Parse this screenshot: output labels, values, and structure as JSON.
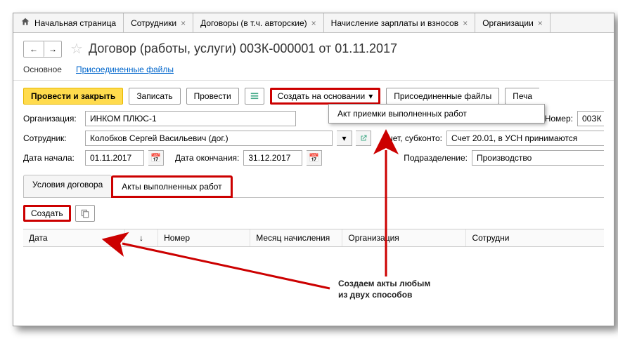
{
  "tabs": {
    "home": "Начальная страница",
    "t1": "Сотрудники",
    "t2": "Договоры (в т.ч. авторские)",
    "t3": "Начисление зарплаты и взносов",
    "t4": "Организации"
  },
  "title": "Договор (работы, услуги) 00ЗК-000001 от 01.11.2017",
  "subTabs": {
    "main": "Основное",
    "files": "Присоединенные файлы"
  },
  "toolbar": {
    "postClose": "Провести и закрыть",
    "save": "Записать",
    "post": "Провести",
    "createOn": "Создать на основании",
    "attached": "Присоединенные файлы",
    "print": "Печа"
  },
  "dropdown": {
    "item1": "Акт приемки выполненных работ"
  },
  "fields": {
    "orgLabel": "Организация:",
    "orgValue": "ИНКОМ ПЛЮС-1",
    "numLabel": "Номер:",
    "numValue": "00ЗК",
    "empLabel": "Сотрудник:",
    "empValue": "Колобков Сергей Васильевич (дог.)",
    "accLabel": "Счет, субконто:",
    "accValue": "Счет 20.01, в УСН принимаются",
    "startLabel": "Дата начала:",
    "startValue": "01.11.2017",
    "endLabel": "Дата окончания:",
    "endValue": "31.12.2017",
    "divLabel": "Подразделение:",
    "divValue": "Производство"
  },
  "innerTabs": {
    "t1": "Условия договора",
    "t2": "Акты выполненных работ"
  },
  "subToolbar": {
    "create": "Создать"
  },
  "grid": {
    "date": "Дата",
    "arrow": "↓",
    "num": "Номер",
    "month": "Месяц начисления",
    "org": "Организация",
    "emp": "Сотрудни"
  },
  "annotation": {
    "l1": "Создаем акты любым",
    "l2": "из двух способов"
  }
}
